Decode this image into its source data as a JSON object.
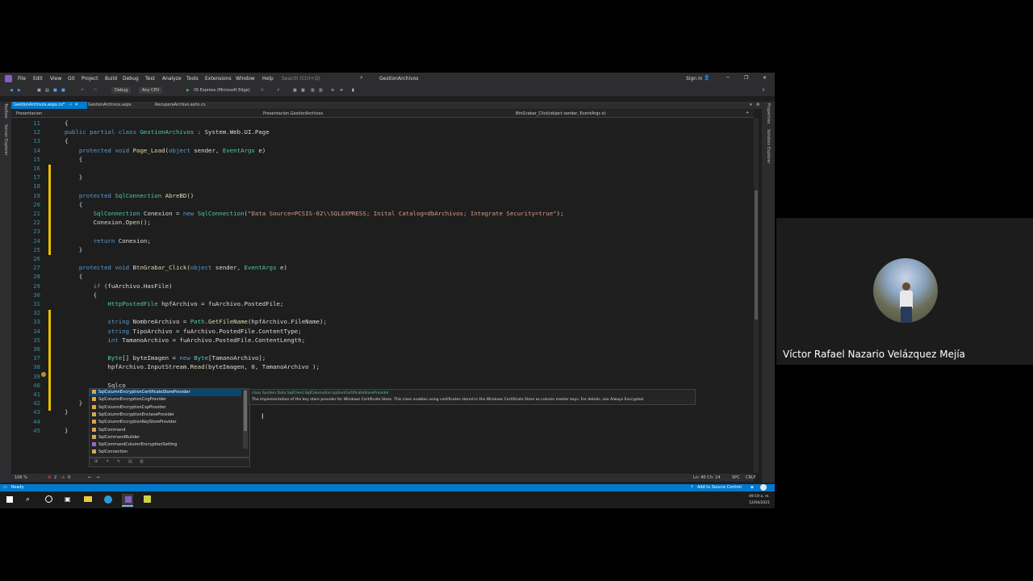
{
  "menu": [
    "File",
    "Edit",
    "View",
    "Git",
    "Project",
    "Build",
    "Debug",
    "Test",
    "Analyze",
    "Tools",
    "Extensions",
    "Window",
    "Help"
  ],
  "search_placeholder": "Search (Ctrl+Q)",
  "solution_name": "GestionArchivos",
  "signin": "Sign in",
  "toolbar": {
    "config": "Debug",
    "platform": "Any CPU",
    "run": "IIS Express (Microsoft Edge)"
  },
  "tabs": [
    {
      "label": "GestionArchivos.aspx.cs*",
      "active": true
    },
    {
      "label": "GestionArchivos.aspx"
    },
    {
      "label": "RecuperaArchivo.ashx.cs"
    }
  ],
  "nav": {
    "project": "Presentacion",
    "class": "Presentacion.GestionArchivos",
    "member": "BtnGrabar_Click(object sender, EventArgs e)"
  },
  "left_tools": [
    "Toolbox",
    "Server Explorer"
  ],
  "right_tools": [
    "Properties",
    "Solution Explorer"
  ],
  "line_numbers": [
    "11",
    "12",
    "13",
    "14",
    "15",
    "16",
    "17",
    "18",
    "19",
    "20",
    "21",
    "22",
    "23",
    "24",
    "25",
    "26",
    "27",
    "28",
    "29",
    "30",
    "31",
    "32",
    "33",
    "34",
    "35",
    "36",
    "37",
    "38",
    "39",
    "40",
    "41",
    "42",
    "43",
    "44",
    "45"
  ],
  "autocomplete": {
    "items": [
      "SqlColumnEncryptionCertificateStoreProvider",
      "SqlColumnEncryptionCngProvider",
      "SqlColumnEncryptionCspProvider",
      "SqlColumnEncryptionEnclaveProvider",
      "SqlColumnEncryptionKeyStoreProvider",
      "SqlCommand",
      "SqlCommandBuilder",
      "SqlCommandColumnEncryptionSetting",
      "SqlConnection"
    ],
    "tooltip_title": "class System.Data.SqlClient.SqlColumnEncryptionCertificateStoreProvider",
    "tooltip_body": "The implementation of the key store provider for Windows Certificate Store. This class enables using certificates stored in the Windows Certificate Store as column master keys. For details, see Always Encrypted."
  },
  "status": {
    "ready": "Ready",
    "zoom": "106 %",
    "errors": "2",
    "warnings": "0",
    "position": "Ln: 40   Ch: 14",
    "spc": "SPC",
    "crlf": "CRLF",
    "source_control": "Add to Source Control"
  },
  "taskbar": {
    "time": "09:19 a. m.",
    "date": "12/04/2021"
  },
  "participant": {
    "name": "Víctor Rafael Nazario Velázquez Mejía"
  }
}
